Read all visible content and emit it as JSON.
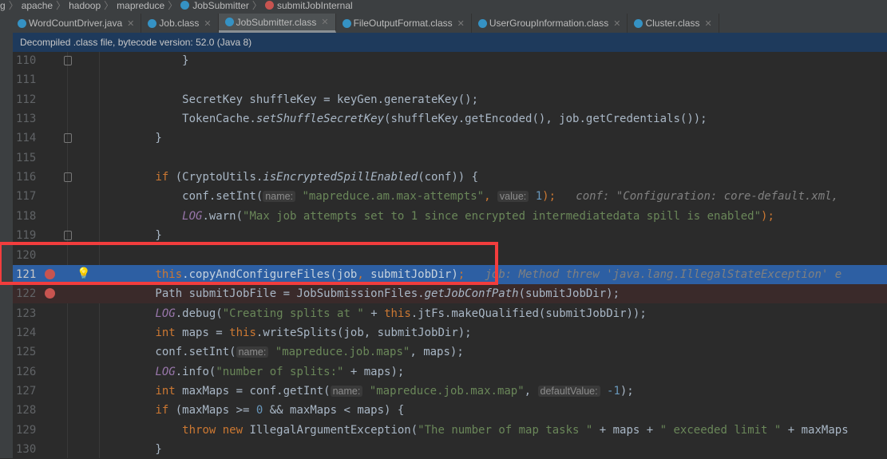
{
  "breadcrumb": [
    "g",
    "apache",
    "hadoop",
    "mapreduce",
    "JobSubmitter",
    "submitJobInternal"
  ],
  "tabs": [
    {
      "label": "WordCountDriver.java",
      "active": false
    },
    {
      "label": "Job.class",
      "active": false
    },
    {
      "label": "JobSubmitter.class",
      "active": true
    },
    {
      "label": "FileOutputFormat.class",
      "active": false
    },
    {
      "label": "UserGroupInformation.class",
      "active": false
    },
    {
      "label": "Cluster.class",
      "active": false
    }
  ],
  "banner": "Decompiled .class file, bytecode version: 52.0 (Java 8)",
  "colors": {
    "selection": "#2d5fa3",
    "breakpoint": "#c75450",
    "highlight_frame": "#f23d3d",
    "keyword": "#cc7832",
    "string": "#6a8759"
  },
  "lines": [
    {
      "n": "110",
      "t": [
        [
          "            }",
          ""
        ]
      ]
    },
    {
      "n": "111",
      "t": []
    },
    {
      "n": "112",
      "t": [
        [
          "            SecretKey shuffleKey = keyGen.generateKey();",
          ""
        ]
      ]
    },
    {
      "n": "113",
      "t": [
        [
          "            TokenCache.",
          ""
        ],
        [
          "setShuffleSecretKey",
          "it"
        ],
        [
          "(shuffleKey.getEncoded(), job.getCredentials());",
          ""
        ]
      ]
    },
    {
      "n": "114",
      "t": [
        [
          "        }",
          ""
        ]
      ]
    },
    {
      "n": "115",
      "t": []
    },
    {
      "n": "116",
      "t": [
        [
          "        ",
          ""
        ],
        [
          "if",
          "kw"
        ],
        [
          " (CryptoUtils.",
          ""
        ],
        [
          "isEncryptedSpillEnabled",
          "it"
        ],
        [
          "(conf)) {",
          ""
        ]
      ]
    },
    {
      "n": "117",
      "t": [
        [
          "            conf.setInt(",
          ""
        ],
        [
          "name:",
          "hint"
        ],
        [
          " ",
          ""
        ],
        [
          "\"mapreduce.am.max-attempts\"",
          "str"
        ],
        [
          ", ",
          "kw"
        ],
        [
          "value:",
          "hint"
        ],
        [
          " ",
          ""
        ],
        [
          "1",
          "num"
        ],
        [
          ");",
          "kw"
        ],
        [
          "   conf: \"Configuration: core-default.xml, ",
          "cm"
        ]
      ]
    },
    {
      "n": "118",
      "t": [
        [
          "            ",
          ""
        ],
        [
          "LOG",
          "st"
        ],
        [
          ".warn(",
          ""
        ],
        [
          "\"Max job attempts set to 1 since encrypted intermediatedata spill is enabled\"",
          "str"
        ],
        [
          ");",
          "kw"
        ]
      ]
    },
    {
      "n": "119",
      "t": [
        [
          "        }",
          ""
        ]
      ]
    },
    {
      "n": "120",
      "t": []
    },
    {
      "n": "121",
      "t": [
        [
          "        ",
          ""
        ],
        [
          "this",
          "kw"
        ],
        [
          ".copyAndConfigureFiles(job",
          ""
        ],
        [
          ", ",
          "kw"
        ],
        [
          "submitJobDir)",
          ""
        ],
        [
          ";",
          "kw"
        ],
        [
          "   job: Method threw 'java.lang.IllegalStateException' e",
          "cm"
        ]
      ],
      "selected": true,
      "breakpoint": true,
      "bulb": "💡"
    },
    {
      "n": "122",
      "t": [
        [
          "        Path submitJobFile = JobSubmissionFiles.",
          ""
        ],
        [
          "getJobConfPath",
          "it"
        ],
        [
          "(submitJobDir);",
          ""
        ]
      ],
      "error": true,
      "breakpoint": true
    },
    {
      "n": "123",
      "t": [
        [
          "        ",
          ""
        ],
        [
          "LOG",
          "st"
        ],
        [
          ".debug(",
          ""
        ],
        [
          "\"Creating splits at \"",
          "str"
        ],
        [
          " + ",
          ""
        ],
        [
          "this",
          "kw"
        ],
        [
          ".jtFs.makeQualified(submitJobDir));",
          ""
        ]
      ]
    },
    {
      "n": "124",
      "t": [
        [
          "        ",
          ""
        ],
        [
          "int",
          "kw"
        ],
        [
          " maps = ",
          ""
        ],
        [
          "this",
          "kw"
        ],
        [
          ".writeSplits(job, submitJobDir);",
          ""
        ]
      ]
    },
    {
      "n": "125",
      "t": [
        [
          "        conf.setInt(",
          ""
        ],
        [
          "name:",
          "hint"
        ],
        [
          " ",
          ""
        ],
        [
          "\"mapreduce.job.maps\"",
          "str"
        ],
        [
          ", maps);",
          ""
        ]
      ]
    },
    {
      "n": "126",
      "t": [
        [
          "        ",
          ""
        ],
        [
          "LOG",
          "st"
        ],
        [
          ".info(",
          ""
        ],
        [
          "\"number of splits:\"",
          "str"
        ],
        [
          " + maps);",
          ""
        ]
      ]
    },
    {
      "n": "127",
      "t": [
        [
          "        ",
          ""
        ],
        [
          "int",
          "kw"
        ],
        [
          " maxMaps = conf.getInt(",
          ""
        ],
        [
          "name:",
          "hint"
        ],
        [
          " ",
          ""
        ],
        [
          "\"mapreduce.job.max.map\"",
          "str"
        ],
        [
          ", ",
          ""
        ],
        [
          "defaultValue:",
          "hint"
        ],
        [
          " ",
          ""
        ],
        [
          "-1",
          "num"
        ],
        [
          ");",
          ""
        ]
      ]
    },
    {
      "n": "128",
      "t": [
        [
          "        ",
          ""
        ],
        [
          "if",
          "kw"
        ],
        [
          " (maxMaps >= ",
          ""
        ],
        [
          "0",
          "num"
        ],
        [
          " && maxMaps < maps) {",
          ""
        ]
      ]
    },
    {
      "n": "129",
      "t": [
        [
          "            ",
          ""
        ],
        [
          "throw new",
          "kw"
        ],
        [
          " IllegalArgumentException(",
          ""
        ],
        [
          "\"The number of map tasks \"",
          "str"
        ],
        [
          " + maps + ",
          ""
        ],
        [
          "\" exceeded limit \"",
          "str"
        ],
        [
          " + maxMaps",
          ""
        ]
      ]
    },
    {
      "n": "130",
      "t": [
        [
          "        }",
          ""
        ]
      ]
    }
  ]
}
